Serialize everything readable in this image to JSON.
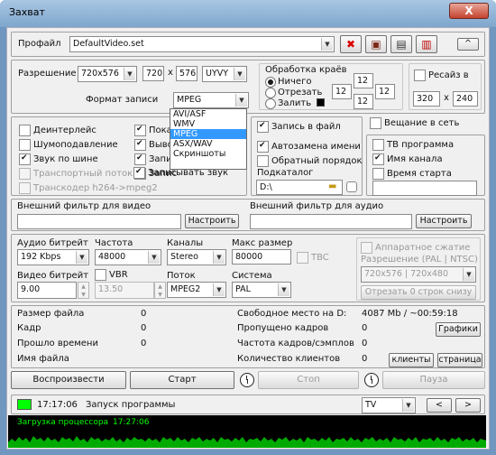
{
  "window": {
    "title": "Захват",
    "close": "X"
  },
  "profile": {
    "label": "Профайл",
    "value": "DefaultVideo.set",
    "collapse": "^",
    "icons": [
      "close-red-icon",
      "film-reel-icon",
      "film-save-icon",
      "floppy-save-icon"
    ],
    "icon_glyphs": [
      "✖",
      "▣",
      "▤",
      "▥"
    ]
  },
  "resolution": {
    "label": "Разрешение",
    "size": "720x576",
    "w": "720",
    "x": "x",
    "h": "576",
    "format": "UYVY",
    "record_format_label": "Формат записи",
    "record_format": "MPEG",
    "options": [
      "AVI/ASF",
      "WMV",
      "MPEG",
      "ASX/WAV",
      "Скриншоты"
    ],
    "selected_index": 2
  },
  "edges": {
    "title": "Обработка краёв",
    "options": [
      "Ничего",
      "Отрезать",
      "Залить"
    ],
    "selected": 0,
    "v1": "12",
    "v2": "12",
    "v3": "12",
    "v4": "12"
  },
  "resize": {
    "label": "Ресайз в",
    "w": "320",
    "x": "x",
    "h": "240"
  },
  "video_opts": [
    {
      "label": "Деинтерлейс",
      "checked": false
    },
    {
      "label": "Шумоподавление",
      "checked": false
    },
    {
      "label": "Звук по шине",
      "checked": true
    },
    {
      "label": "Транспортный поток",
      "checked": false,
      "disabled": true
    },
    {
      "label": "Транскодер h264->mpeg2",
      "checked": false,
      "disabled": true
    }
  ],
  "mid_opts": [
    {
      "label": "Пока",
      "checked": true
    },
    {
      "label": "Выво",
      "checked": true
    },
    {
      "label": "Запис",
      "checked": true
    },
    {
      "label": "Запис",
      "checked": true
    },
    {
      "label": "Записывать звук",
      "checked": true
    }
  ],
  "file": {
    "write_file": "Запись в файл",
    "write_file_checked": true,
    "auto_rename": "Автозамена имени",
    "auto_rename_checked": true,
    "reverse_order": "Обратный порядок",
    "reverse_order_checked": false,
    "subdir_label": "Подкаталог",
    "subdir": "D:\\"
  },
  "broadcast": {
    "label": "Вещание в сеть",
    "checked": false
  },
  "tv": {
    "program": "ТВ программа",
    "program_checked": false,
    "channel": "Имя канала",
    "channel_checked": true,
    "start": "Время старта",
    "start_checked": false
  },
  "filters": {
    "video_label": "Внешний фильтр для видео",
    "audio_label": "Внешний фильтр для аудио",
    "configure": "Настроить"
  },
  "audio": {
    "bitrate_label": "Аудио битрейт",
    "bitrate": "192 Kbps",
    "freq_label": "Частота",
    "freq": "48000",
    "channels_label": "Каналы",
    "channels": "Stereo",
    "maxsize_label": "Макс размер",
    "maxsize": "80000",
    "tbc": "TBC"
  },
  "video": {
    "bitrate_label": "Видео битрейт",
    "bitrate": "9.00",
    "vbr": "VBR",
    "vbr_value": "13.50",
    "stream_label": "Поток",
    "stream": "MPEG2",
    "system_label": "Система",
    "system": "PAL"
  },
  "hw": {
    "label": "Аппаратное сжатие",
    "res_label": "Разрешение (PAL | NTSC)",
    "res": "720x576 | 720x480",
    "cut_btn": "Отрезать 0 строк снизу"
  },
  "stats": {
    "filesize_label": "Размер файла",
    "filesize": "0",
    "frame_label": "Кадр",
    "frame": "0",
    "elapsed_label": "Прошло времени",
    "elapsed": "0",
    "filename_label": "Имя файла",
    "free_label": "Свободное место на D:",
    "free": "4087 Mb / ~00:59:18",
    "skipped_label": "Пропущено кадров",
    "skipped": "0",
    "graphs": "Графики",
    "rate_label": "Частота кадров/сэмплов",
    "rate": "0",
    "clients_label": "Количество клиентов",
    "clients": "0",
    "clients_btn": "клиенты",
    "page_btn": "страница"
  },
  "controls": {
    "play": "Воспроизвести",
    "start": "Старт",
    "stop": "Стоп",
    "pause": "Пауза"
  },
  "status": {
    "time": "17:17:06",
    "message": "Запуск программы",
    "tv": "TV",
    "prev": "<",
    "next": ">"
  },
  "cpu": {
    "label": "Загрузка процессора",
    "time": "17:27:06",
    "color": "#00ff00",
    "accent": "#3399ff"
  }
}
